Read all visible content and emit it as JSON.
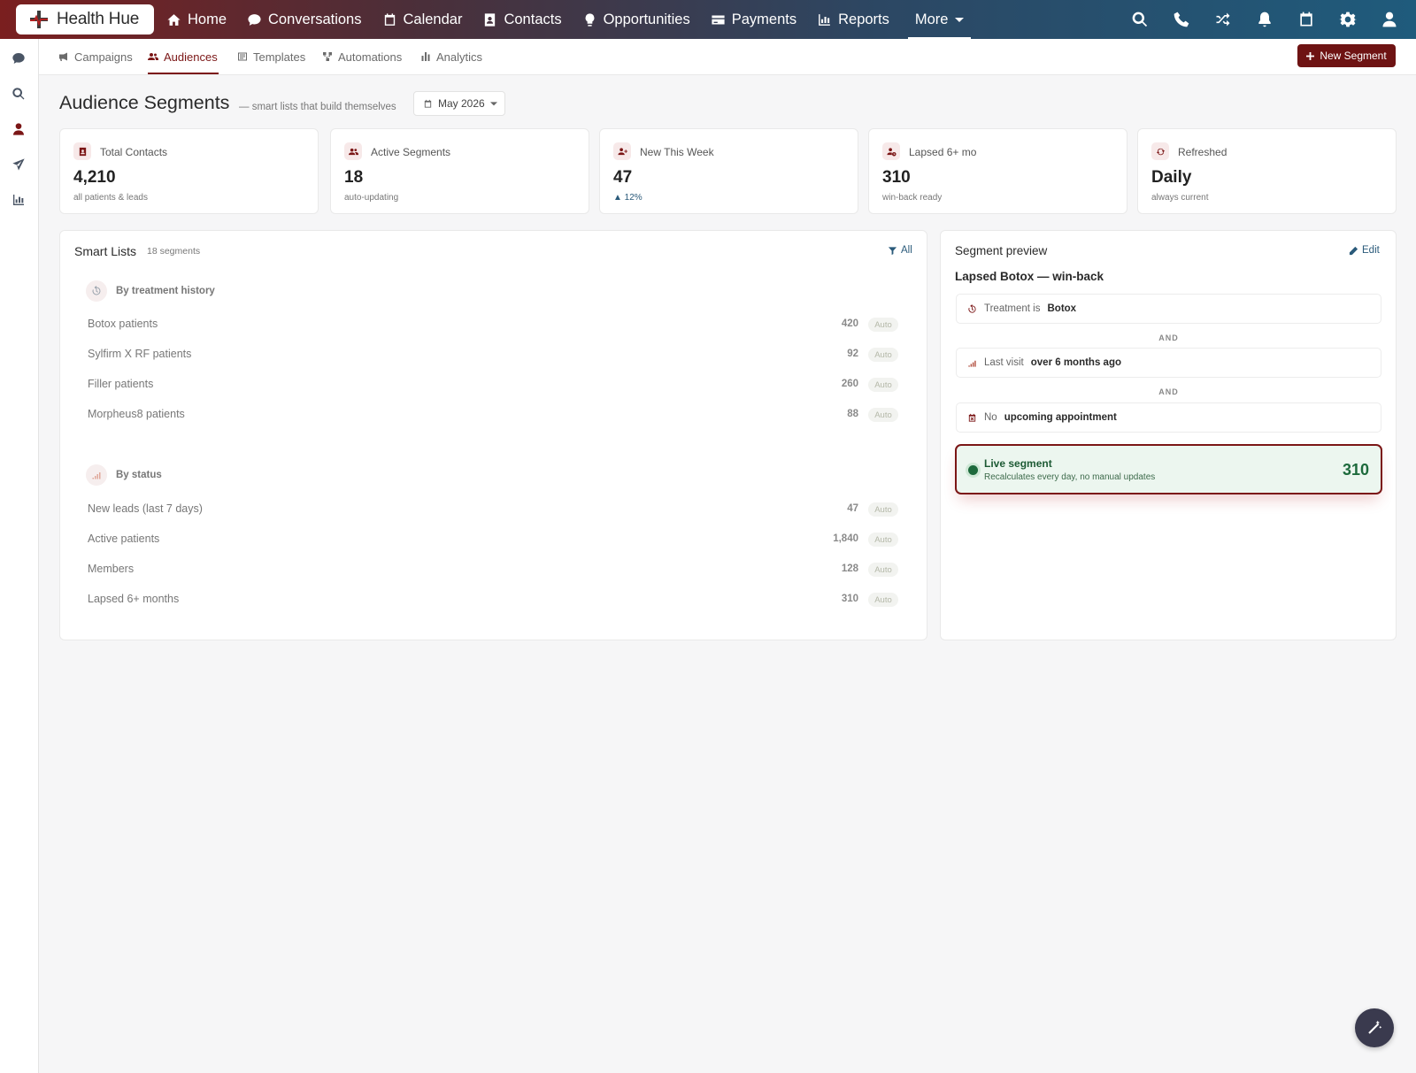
{
  "brand": {
    "name": "Health Hue"
  },
  "topnav": {
    "items": [
      {
        "label": "Home",
        "icon": "home-icon"
      },
      {
        "label": "Conversations",
        "icon": "chat-icon"
      },
      {
        "label": "Calendar",
        "icon": "calendar-icon"
      },
      {
        "label": "Contacts",
        "icon": "contact-card-icon"
      },
      {
        "label": "Opportunities",
        "icon": "lightbulb-icon"
      },
      {
        "label": "Payments",
        "icon": "credit-card-icon"
      },
      {
        "label": "Reports",
        "icon": "bar-chart-icon"
      }
    ],
    "more_label": "More",
    "right_icons": [
      "search-icon",
      "phone-icon",
      "shuffle-icon",
      "bell-icon",
      "calendar-icon",
      "gear-icon",
      "user-icon"
    ]
  },
  "rail": {
    "icons": [
      "chat-icon",
      "search-icon",
      "user-icon",
      "paper-plane-icon",
      "bar-chart-icon"
    ]
  },
  "subnav": {
    "tabs": [
      {
        "label": "Campaigns",
        "icon": "megaphone-icon"
      },
      {
        "label": "Audiences",
        "icon": "users-icon",
        "active": true
      },
      {
        "label": "Templates",
        "icon": "template-icon"
      },
      {
        "label": "Automations",
        "icon": "workflow-icon"
      },
      {
        "label": "Analytics",
        "icon": "bar-chart-icon"
      }
    ],
    "new_button": "New Segment"
  },
  "header": {
    "title": "Audience Segments",
    "subtitle": "— smart lists that build themselves",
    "date_filter": "May 2026"
  },
  "stats": [
    {
      "label": "Total Contacts",
      "value": "4,210",
      "sub": "all patients & leads",
      "icon": "contact-card-icon"
    },
    {
      "label": "Active Segments",
      "value": "18",
      "sub": "auto-updating",
      "icon": "users-icon"
    },
    {
      "label": "New This Week",
      "value": "47",
      "sub": "▲ 12%",
      "icon": "user-plus-icon"
    },
    {
      "label": "Lapsed 6+ mo",
      "value": "310",
      "sub": "win-back ready",
      "icon": "user-clock-icon"
    },
    {
      "label": "Refreshed",
      "value": "Daily",
      "sub": "always current",
      "icon": "refresh-icon"
    }
  ],
  "smart_lists": {
    "title": "Smart Lists",
    "count_label": "18 segments",
    "filter_label": "All",
    "groups": [
      {
        "heading": "By treatment history",
        "icon": "history-icon",
        "rows": [
          {
            "name": "Botox patients",
            "count": "420",
            "badge": "Auto"
          },
          {
            "name": "Sylfirm X RF patients",
            "count": "92",
            "badge": "Auto"
          },
          {
            "name": "Filler patients",
            "count": "260",
            "badge": "Auto"
          },
          {
            "name": "Morpheus8 patients",
            "count": "88",
            "badge": "Auto"
          }
        ]
      },
      {
        "heading": "By status",
        "icon": "signal-icon",
        "rows": [
          {
            "name": "New leads (last 7 days)",
            "count": "47",
            "badge": "Auto"
          },
          {
            "name": "Active patients",
            "count": "1,840",
            "badge": "Auto"
          },
          {
            "name": "Members",
            "count": "128",
            "badge": "Auto"
          },
          {
            "name": "Lapsed 6+ months",
            "count": "310",
            "badge": "Auto"
          }
        ]
      }
    ]
  },
  "preview": {
    "title": "Segment preview",
    "edit_label": "Edit",
    "segment_name": "Lapsed Botox — win-back",
    "conditions": [
      {
        "prefix": "Treatment is",
        "value": "Botox",
        "icon": "history-icon"
      },
      {
        "prefix": "Last visit",
        "value": "over 6 months ago",
        "icon": "signal-icon"
      },
      {
        "prefix": "No",
        "value": "upcoming appointment",
        "icon": "calendar-x-icon"
      }
    ],
    "joiner": "AND",
    "live": {
      "title": "Live segment",
      "subtitle": "Recalculates every day, no manual updates",
      "count": "310"
    }
  },
  "fab": {
    "icon": "magic-wand-icon"
  },
  "colors": {
    "brand": "#7b1616",
    "accent_blue": "#1f5b7c",
    "live_green": "#1d6a3c"
  }
}
